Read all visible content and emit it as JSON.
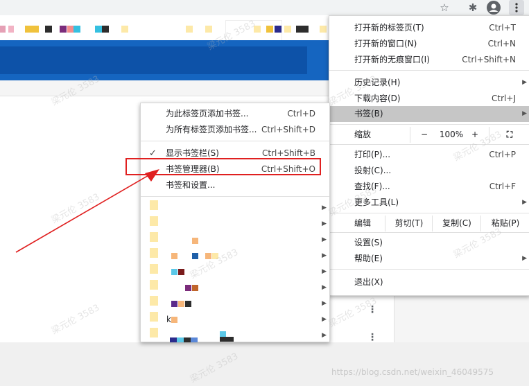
{
  "toolbar": {
    "icons": [
      "star-icon",
      "extensions-icon",
      "profile-icon",
      "kebab-menu-icon"
    ]
  },
  "main_menu": {
    "items_group1": [
      {
        "label": "打开新的标签页(T)",
        "shortcut": "Ctrl+T"
      },
      {
        "label": "打开新的窗口(N)",
        "shortcut": "Ctrl+N"
      },
      {
        "label": "打开新的无痕窗口(I)",
        "shortcut": "Ctrl+Shift+N"
      }
    ],
    "items_group2": [
      {
        "label": "历史记录(H)",
        "shortcut": ""
      },
      {
        "label": "下载内容(D)",
        "shortcut": "Ctrl+J"
      },
      {
        "label": "书签(B)",
        "shortcut": ""
      }
    ],
    "zoom": {
      "label": "缩放",
      "minus": "−",
      "value": "100%",
      "plus": "+"
    },
    "items_group3": [
      {
        "label": "打印(P)...",
        "shortcut": "Ctrl+P"
      },
      {
        "label": "投射(C)...",
        "shortcut": ""
      },
      {
        "label": "查找(F)...",
        "shortcut": "Ctrl+F"
      },
      {
        "label": "更多工具(L)",
        "shortcut": ""
      }
    ],
    "edit": {
      "label": "编辑",
      "cut": "剪切(T)",
      "copy": "复制(C)",
      "paste": "粘贴(P)"
    },
    "items_group4": [
      {
        "label": "设置(S)"
      },
      {
        "label": "帮助(E)"
      }
    ],
    "exit": "退出(X)"
  },
  "bookmarks_menu": {
    "items": [
      {
        "label": "为此标签页添加书签...",
        "shortcut": "Ctrl+D"
      },
      {
        "label": "为所有标签页添加书签...",
        "shortcut": "Ctrl+Shift+D"
      },
      {
        "label": "显示书签栏(S)",
        "shortcut": "Ctrl+Shift+B",
        "checked": "✓"
      },
      {
        "label": "书签管理器(B)",
        "shortcut": "Ctrl+Shift+O"
      },
      {
        "label": "书签和设置..."
      }
    ],
    "folder_letter": "k"
  },
  "annotation": {
    "highlight_color": "#e02020"
  },
  "footer": {
    "credit": "https://blog.csdn.net/weixin_46049575"
  }
}
